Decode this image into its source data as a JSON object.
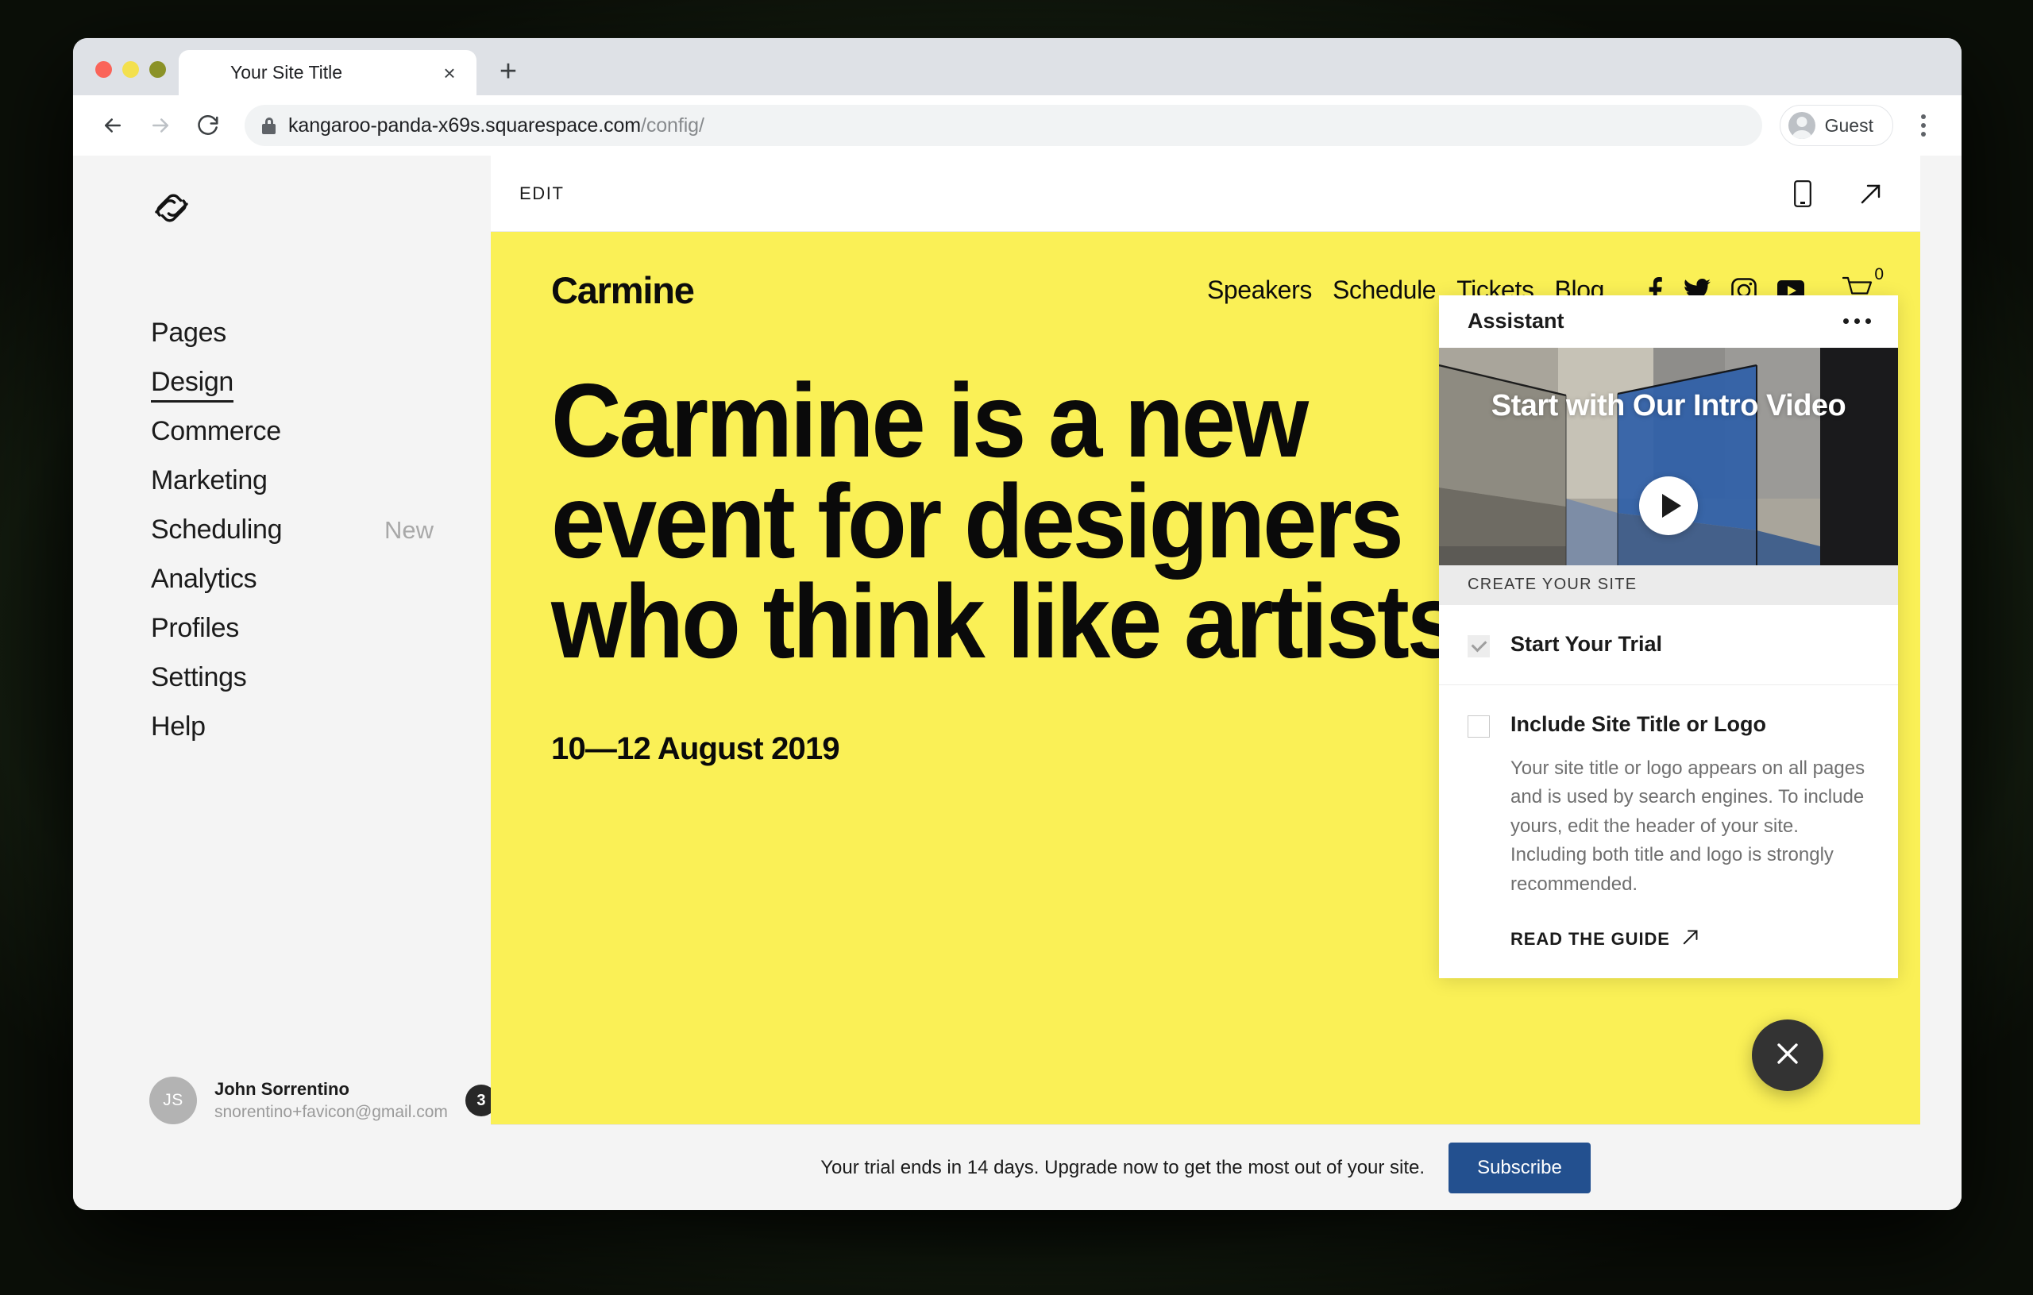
{
  "browser": {
    "tab": {
      "title": "Your Site Title",
      "favicon_icon": "cube-favicon",
      "close_icon": "close-icon"
    },
    "new_tab_icon": "plus-icon",
    "back_icon": "arrow-left-icon",
    "forward_icon": "arrow-right-icon",
    "reload_icon": "reload-icon",
    "lock_icon": "lock-icon",
    "url_domain": "kangaroo-panda-x69s.squarespace.com",
    "url_path": "/config/",
    "profile_label": "Guest",
    "profile_icon": "person-icon",
    "menu_icon": "kebab-menu-icon"
  },
  "sidebar": {
    "logo_icon": "squarespace-logo",
    "items": [
      {
        "label": "Pages",
        "badge": "",
        "active": false
      },
      {
        "label": "Design",
        "badge": "",
        "active": true
      },
      {
        "label": "Commerce",
        "badge": "",
        "active": false
      },
      {
        "label": "Marketing",
        "badge": "",
        "active": false
      },
      {
        "label": "Scheduling",
        "badge": "New",
        "active": false
      },
      {
        "label": "Analytics",
        "badge": "",
        "active": false
      },
      {
        "label": "Profiles",
        "badge": "",
        "active": false
      },
      {
        "label": "Settings",
        "badge": "",
        "active": false
      },
      {
        "label": "Help",
        "badge": "",
        "active": false
      }
    ],
    "user": {
      "initials": "JS",
      "name": "John Sorrentino",
      "email": "snorentino+favicon@gmail.com",
      "notification_count": "3"
    }
  },
  "editbar": {
    "label": "EDIT",
    "mobile_icon": "mobile-device-icon",
    "open_icon": "external-link-icon"
  },
  "site": {
    "background_color": "#faf056",
    "logo": "Carmine",
    "nav": [
      "Speakers",
      "Schedule",
      "Tickets",
      "Blog"
    ],
    "socials": [
      "facebook-icon",
      "twitter-icon",
      "instagram-icon",
      "youtube-icon"
    ],
    "cart_icon": "shopping-cart-icon",
    "cart_count": "0",
    "headline": "Carmine is a new event for designers who think like artists",
    "date": "10—12 August 2019"
  },
  "assistant": {
    "title": "Assistant",
    "more_icon": "ellipsis-icon",
    "video": {
      "title": "Start with Our Intro Video",
      "play_icon": "play-icon"
    },
    "section_label": "CREATE YOUR SITE",
    "tasks": [
      {
        "title": "Start Your Trial",
        "checked": true,
        "desc": "",
        "link": "",
        "link_icon": ""
      },
      {
        "title": "Include Site Title or Logo",
        "checked": false,
        "desc": "Your site title or logo appears on all pages and is used by search engines. To include yours, edit the header of your site. Including both title and logo is strongly recommended.",
        "link": "READ THE GUIDE",
        "link_icon": "external-link-icon"
      }
    ]
  },
  "close_fab": {
    "icon": "close-icon"
  },
  "trial": {
    "message": "Your trial ends in 14 days. Upgrade now to get the most out of your site.",
    "button_label": "Subscribe",
    "button_color": "#23508f"
  }
}
